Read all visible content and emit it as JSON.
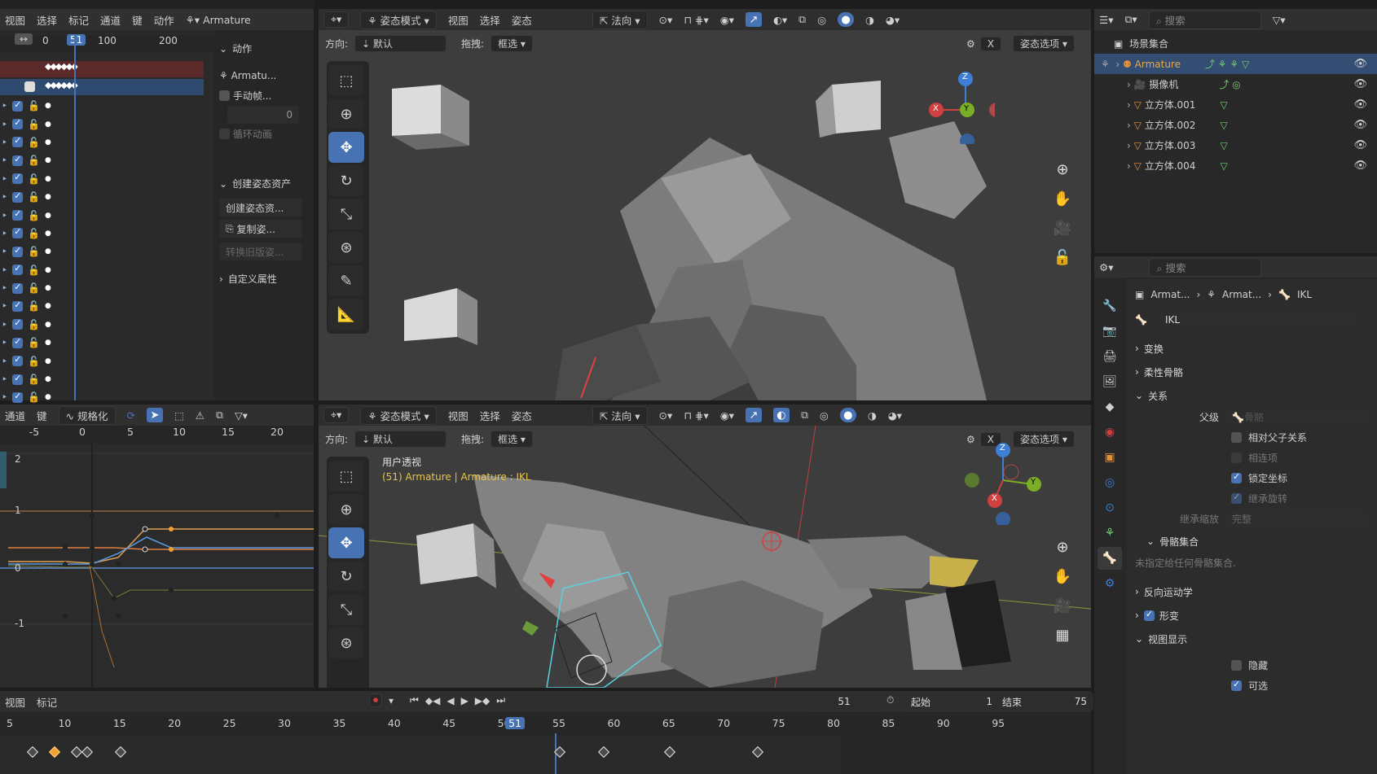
{
  "dopesheet": {
    "menu": [
      "视图",
      "选择",
      "标记",
      "通道",
      "键",
      "动作"
    ],
    "armature_label": "Armature",
    "ruler": [
      "0",
      "51",
      "100",
      "200"
    ],
    "current_frame": "51"
  },
  "action_panel": {
    "title": "动作",
    "armature": "Armatu...",
    "manual_frame": "手动帧...",
    "manual_value": "0",
    "cycle": "循环动画",
    "pose_asset_title": "创建姿态资产",
    "create_btn": "创建姿态资...",
    "copy_btn": "复制姿...",
    "convert_btn": "转换旧版姿...",
    "custom_props": "自定义属性"
  },
  "viewport_top": {
    "mode": "姿态模式",
    "menu": [
      "视图",
      "选择",
      "姿态"
    ],
    "orientation": "法向",
    "direction_label": "方向:",
    "direction_value": "默认",
    "drag_label": "拖拽:",
    "drag_value": "框选",
    "x_label": "X",
    "pose_options": "姿态选项",
    "gizmo_axes": [
      "Z",
      "Y",
      "X"
    ]
  },
  "viewport_bottom": {
    "mode": "姿态模式",
    "menu": [
      "视图",
      "选择",
      "姿态"
    ],
    "orientation": "法向",
    "direction_label": "方向:",
    "direction_value": "默认",
    "drag_label": "拖拽:",
    "drag_value": "框选",
    "x_label": "X",
    "pose_options": "姿态选项",
    "view_name": "用户透视",
    "object_info": "(51) Armature | Armature : IKL",
    "gizmo_axes": [
      "Z",
      "Y",
      "X"
    ]
  },
  "graph_editor": {
    "menu": [
      "通道",
      "键"
    ],
    "normalize": "规格化",
    "ruler": [
      "-5",
      "0",
      "5",
      "10",
      "15",
      "20"
    ],
    "y_labels": [
      "2",
      "1",
      "0",
      "-1"
    ]
  },
  "timeline": {
    "menu": [
      "视图",
      "标记"
    ],
    "current_frame": "51",
    "start_label": "起始",
    "start_value": "1",
    "end_label": "结束",
    "end_value": "75",
    "ruler": [
      "5",
      "10",
      "15",
      "20",
      "25",
      "30",
      "35",
      "40",
      "45",
      "50",
      "51",
      "55",
      "60",
      "65",
      "70",
      "75",
      "80",
      "85",
      "90",
      "95"
    ]
  },
  "outliner": {
    "search_placeholder": "搜索",
    "collection": "场景集合",
    "items": [
      "Armature",
      "摄像机",
      "立方体.001",
      "立方体.002",
      "立方体.003",
      "立方体.004"
    ]
  },
  "properties": {
    "search_placeholder": "搜索",
    "breadcrumb": [
      "Armat...",
      "Armat...",
      "IKL"
    ],
    "bone_name": "IKL",
    "sections": {
      "transform": "变换",
      "bendy": "柔性骨骼",
      "relations": "关系",
      "parent_label": "父级",
      "parent_placeholder": "骨骼",
      "relative_parent": "相对父子关系",
      "connected": "相连项",
      "local_location": "锁定坐标",
      "inherit_rotation": "继承旋转",
      "inherit_scale_label": "继承缩放",
      "inherit_scale_value": "完整",
      "bone_collections": "骨骼集合",
      "unassigned": "未指定给任何骨骼集合.",
      "ik": "反向运动学",
      "deform": "形变",
      "viewport_display": "视图显示",
      "hide": "隐藏",
      "selectable": "可选"
    }
  },
  "colors": {
    "accent": "#4772b3",
    "orange": "#e0913a",
    "red_axis": "#d04040",
    "green_axis": "#7aae24",
    "blue_axis": "#3d7fd6"
  }
}
